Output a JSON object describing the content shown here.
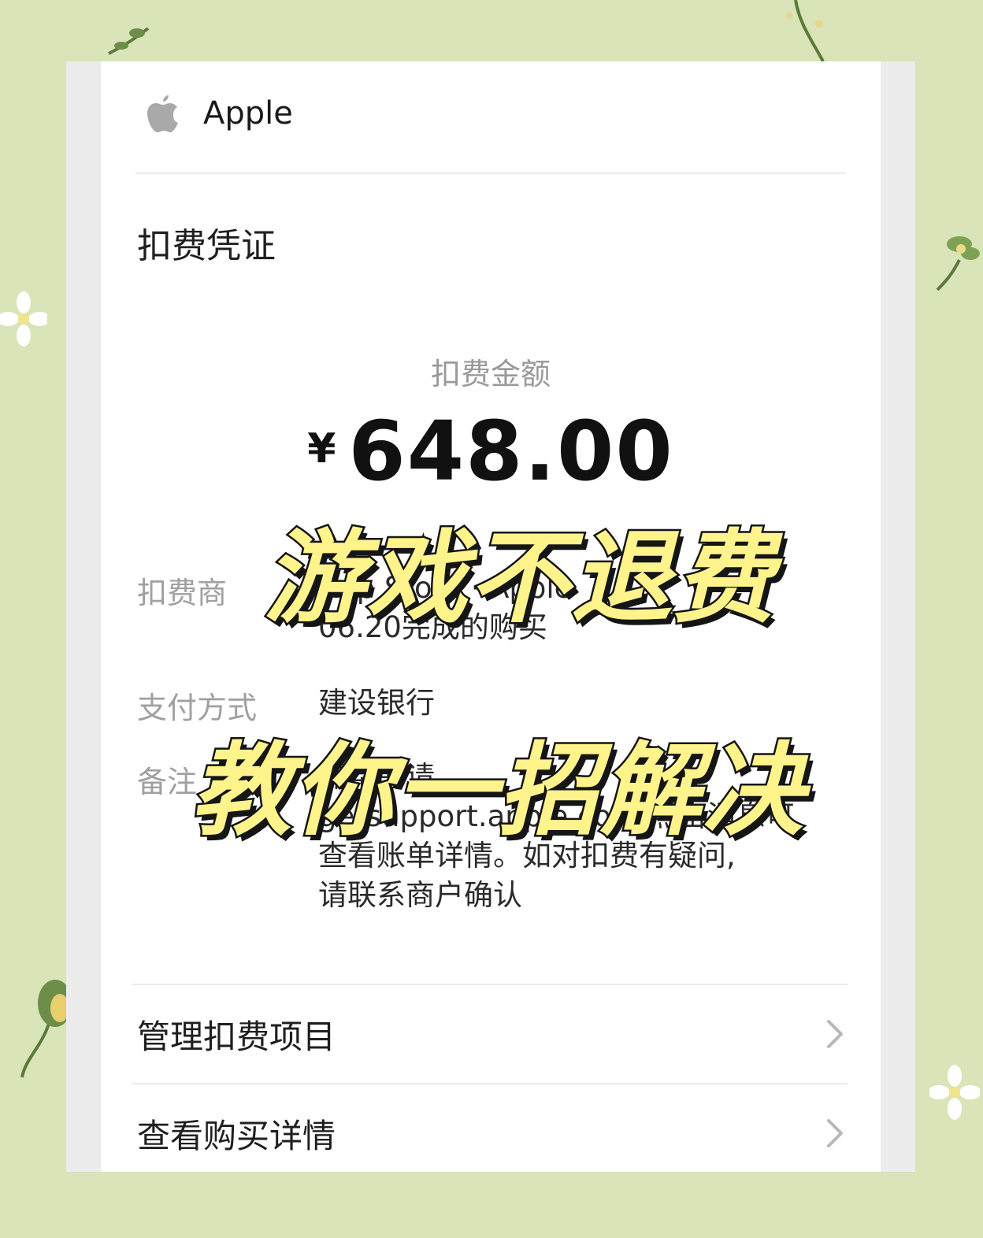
{
  "header": {
    "brand_name": "Apple",
    "logo_icon": "apple-logo-icon"
  },
  "receipt": {
    "title": "扣费凭证",
    "amount_label": "扣费金额",
    "currency_symbol": "¥",
    "amount": "648.00",
    "rows": [
      {
        "label": "扣费商",
        "value_lines": [
          "App Store · Apple",
          "06.20完成的购买"
        ]
      },
      {
        "label": "支付方式",
        "value_lines": [
          "建设银行"
        ]
      },
      {
        "label": "备注",
        "value_lines": [
          "需帮助请",
          "getsupport.apple.com,点击消息可",
          "查看账单详情。如对扣费有疑问,",
          "请联系商户确认"
        ]
      }
    ]
  },
  "menu": [
    {
      "label": "管理扣费项目",
      "icon": "chevron-right-icon"
    },
    {
      "label": "查看购买详情",
      "icon": "chevron-right-icon"
    }
  ],
  "overlay": {
    "line1": "游戏不退费",
    "line2": "教你一招解决"
  },
  "colors": {
    "background": "#d9e4b8",
    "overlay_fill": "#fff38c",
    "overlay_stroke": "#151515"
  }
}
